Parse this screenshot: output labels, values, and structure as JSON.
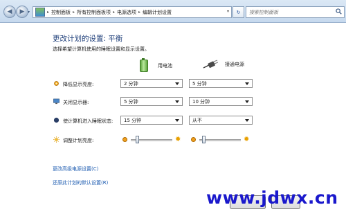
{
  "address_bar": {
    "crumbs": [
      "控制面板",
      "所有控制面板项",
      "电源选项",
      "编辑计划设置"
    ]
  },
  "search": {
    "placeholder": "搜索控制面板"
  },
  "header": {
    "title": "更改计划的设置: 平衡",
    "subtitle": "选择希望计算机使用的睡眠设置和显示设置。"
  },
  "columns": {
    "battery": "用电池",
    "plugged": "接通电源"
  },
  "rows": [
    {
      "label": "降低显示亮度:",
      "battery": "2 分钟",
      "plugged": "5 分钟"
    },
    {
      "label": "关闭显示器:",
      "battery": "5 分钟",
      "plugged": "10 分钟"
    },
    {
      "label": "使计算机进入睡眠状态:",
      "battery": "15 分钟",
      "plugged": "从不"
    }
  ],
  "brightness": {
    "label": "调整计划亮度:",
    "battery_level": 0.12,
    "plugged_level": 0.08
  },
  "links": {
    "advanced": "更改高级电源设置(C)",
    "restore": "还原此计划的默认设置(R)"
  },
  "watermark": "www.jdwx.cn"
}
